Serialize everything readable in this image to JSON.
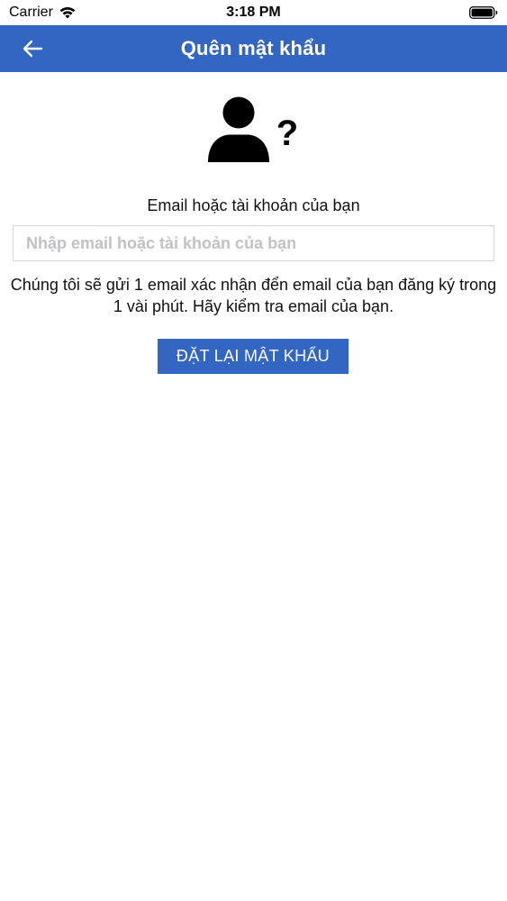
{
  "status_bar": {
    "carrier": "Carrier",
    "time": "3:18 PM",
    "wifi_icon": "wifi-icon",
    "battery_icon": "battery-icon"
  },
  "nav": {
    "title": "Quên mật khẩu",
    "back_icon": "arrow-left-icon",
    "background_color": "#3366c2"
  },
  "illustration": {
    "icon": "user-question-icon"
  },
  "form": {
    "label": "Email hoặc tài khoản của bạn",
    "email_value": "",
    "email_placeholder": "Nhập email hoặc tài khoản của bạn",
    "info_text": "Chúng tôi sẽ gửi 1 email xác nhận đển email của bạn đăng ký trong 1 vài phút. Hãy kiểm tra email của bạn.",
    "submit_label": "ĐẶT LẠI MẬT KHẨU",
    "accent_color": "#3366c2"
  }
}
